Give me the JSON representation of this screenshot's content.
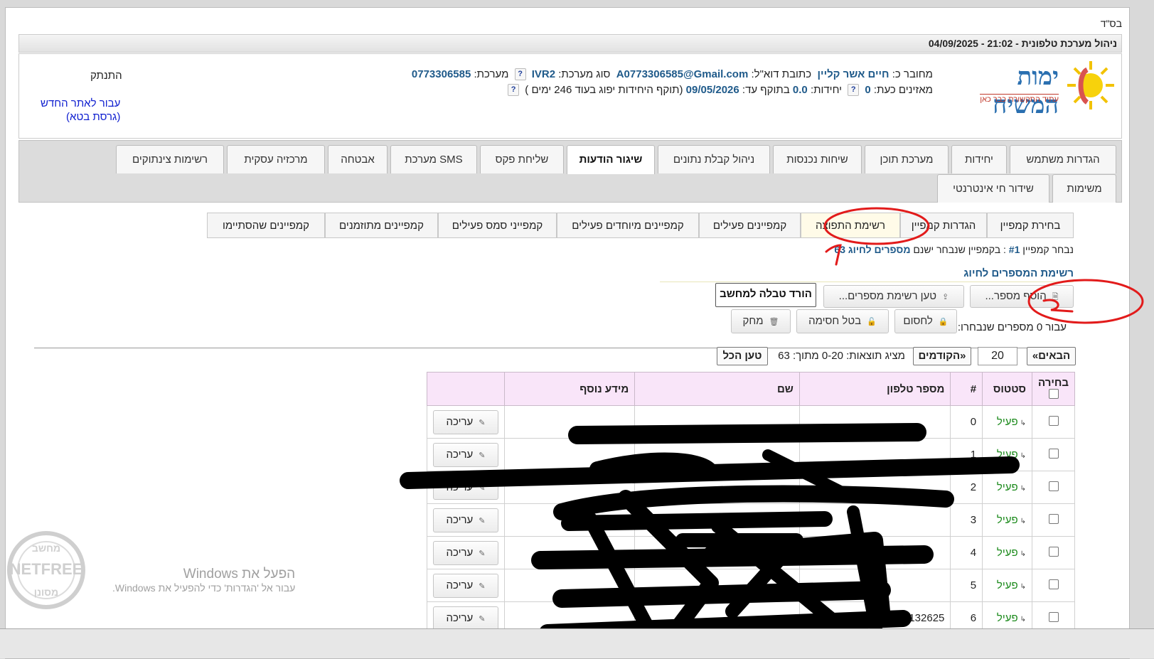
{
  "bsd": "בס\"ד",
  "title": "ניהול מערכת טלפונית - 21:02 - 04/09/2025",
  "logo": {
    "name": "ימות המשיח",
    "tagline": "עתיד התקשורת כבר כאן"
  },
  "account": {
    "connected_label": "מחובר כ:",
    "user_name": "חיים אשר קליין",
    "email_label": "כתובת דוא\"ל:",
    "email": "A0773306585@Gmail.com",
    "system_type_label": "סוג מערכת:",
    "system_type": "IVR2",
    "system_label": "מערכת:",
    "system_number": "0773306585",
    "listeners_label": "מאזינים כעת:",
    "listeners": "0",
    "units_label": "יחידות:",
    "units": "0.0",
    "valid_label": "בתוקף עד:",
    "valid_until": "09/05/2026",
    "expiry_note": "(תוקף היחידות יפוג בעוד 246 ימים )",
    "help": "?"
  },
  "logout": "התנתק",
  "new_site": {
    "line1": "עבור לאתר החדש",
    "line2": "(גרסת בטא)"
  },
  "nav": {
    "row1": [
      "הגדרות משתמש",
      "יחידות",
      "מערכת תוכן",
      "שיחות נכנסות",
      "ניהול קבלת נתונים",
      "שיגור הודעות",
      "שליחת פקס",
      "מערכת SMS",
      "אבטחה",
      "מרכזיה עסקית",
      "רשימות צינתוקים"
    ],
    "row2": [
      "משימות",
      "שידור חי אינטרנטי"
    ],
    "active": "שיגור הודעות"
  },
  "subnav": {
    "tabs": [
      "בחירת קמפיין",
      "הגדרות קמפיין",
      "רשימת התפוצה",
      "קמפיינים פעילים",
      "קמפיינים מיוחדים פעילים",
      "קמפייני סמס פעילים",
      "קמפיינים מתוזמנים",
      "קמפיינים שהסתיימו"
    ],
    "active": "רשימת התפוצה"
  },
  "campaign": {
    "chosen_label": "נבחר קמפיין",
    "campaign_id": "#1",
    "in_campaign": ": בקמפיין שנבחר ישנם",
    "numbers_count": "מספרים לחיוג 63"
  },
  "list_title": "רשימת המספרים לחיוג",
  "actions": {
    "add_number": "הוסף מספר...",
    "load_list": "טען רשימת מספרים...",
    "download": "הורד טבלה למחשב",
    "for_selected": "עבור 0 מספרים שנבחרו:",
    "block": "לחסום",
    "unblock": "בטל חסימה",
    "delete": "מחק"
  },
  "pager": {
    "next": "«הבאים",
    "page_size": "20",
    "prev": "הקודמים»",
    "showing": "מציג תוצאות: 0-20 מתוך: 63",
    "load_all": "טען הכל"
  },
  "table": {
    "headers": [
      "בחירה",
      "סטטוס",
      "#",
      "מספר טלפון",
      "שם",
      "מידע נוסף",
      ""
    ],
    "edit_label": "עריכה",
    "rows": [
      {
        "status": "פעיל",
        "index": "0",
        "phone": "",
        "name": "",
        "extra": ""
      },
      {
        "status": "פעיל",
        "index": "1",
        "phone": "",
        "name": "",
        "extra": ""
      },
      {
        "status": "פעיל",
        "index": "2",
        "phone": "",
        "name": "",
        "extra": ""
      },
      {
        "status": "פעיל",
        "index": "3",
        "phone": "",
        "name": "",
        "extra": ""
      },
      {
        "status": "פעיל",
        "index": "4",
        "phone": "",
        "name": "",
        "extra": ""
      },
      {
        "status": "פעיל",
        "index": "5",
        "phone": "",
        "name": "",
        "extra": ""
      },
      {
        "status": "פעיל",
        "index": "6",
        "phone": "0527132625",
        "name": "",
        "extra": ""
      }
    ]
  },
  "annotations": {
    "mark1": "1",
    "mark2": "2"
  },
  "watermark": {
    "line1": "הפעל את Windows",
    "line2": "עבור אל 'הגדרות' כדי להפעיל את Windows."
  },
  "netfree": {
    "text": "NETFREE",
    "top": "מחשב",
    "bottom": "מסונן"
  },
  "colors": {
    "accent": "#1f5a8a",
    "status_active": "#1b8a1b",
    "header_pink": "#f9e5f9",
    "annotation_red": "#e21b1b"
  }
}
